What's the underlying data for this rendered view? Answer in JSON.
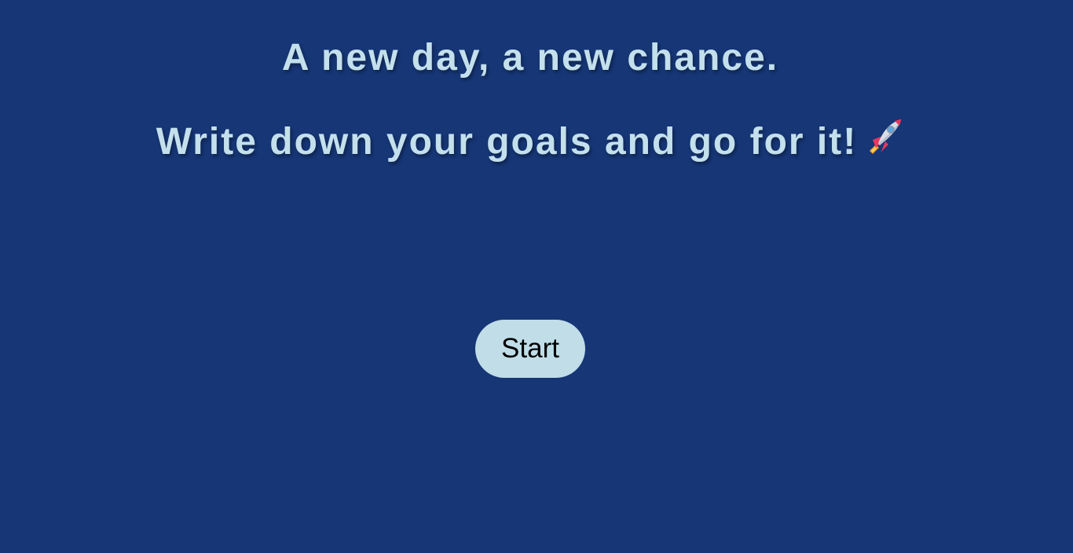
{
  "headline": {
    "line1": "A new day, a new chance.",
    "line2": "Write down your goals and go for it!",
    "line2_icon": "rocket-icon"
  },
  "start_button": {
    "label": "Start"
  },
  "colors": {
    "background": "#163676",
    "heading_text": "#c3e0ec",
    "button_background": "#c0dde8",
    "button_text": "#000000"
  }
}
